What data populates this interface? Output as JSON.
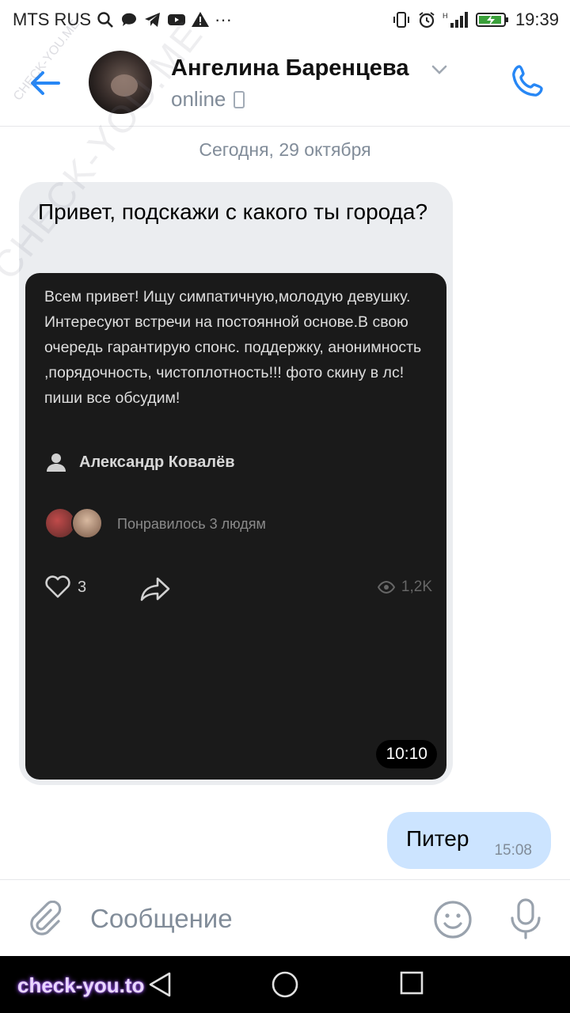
{
  "status_bar": {
    "carrier": "MTS RUS",
    "time": "19:39",
    "icons": [
      "search-icon",
      "chat-bubble-icon",
      "telegram-icon",
      "youtube-icon",
      "warning-icon",
      "more-icon",
      "vibrate-icon",
      "alarm-icon",
      "signal-icon",
      "battery-charging-icon"
    ],
    "more": "···"
  },
  "header": {
    "contact_name": "Ангелина Баренцева",
    "presence": "online",
    "accent_color": "#2787f5"
  },
  "chat": {
    "date_label": "Сегодня, 29 октября",
    "incoming": {
      "text": "Привет, подскажи с какого ты города?",
      "attachment": {
        "text": "Всем привет! Ищу симпатичную,молодую девушку. Интересуют встречи на постоянной основе.В свою очередь гарантирую спонс. поддержку, анонимность ,порядочность, чистоплотность!!! фото скину в лс! пиши все обсудим!",
        "author": "Александр Ковалёв",
        "liked_by": "Понравилось 3 людям",
        "like_count": "3",
        "views": "1,2K",
        "video_time": "10:10"
      }
    },
    "outgoing": {
      "text": "Питер",
      "time": "15:08"
    }
  },
  "composer": {
    "placeholder": "Сообщение"
  },
  "watermarks": {
    "bottom": "check-you.to",
    "diagonal": "CHECK-YOU.ME",
    "diagonal_small": "CHECK-YOU.ME"
  }
}
